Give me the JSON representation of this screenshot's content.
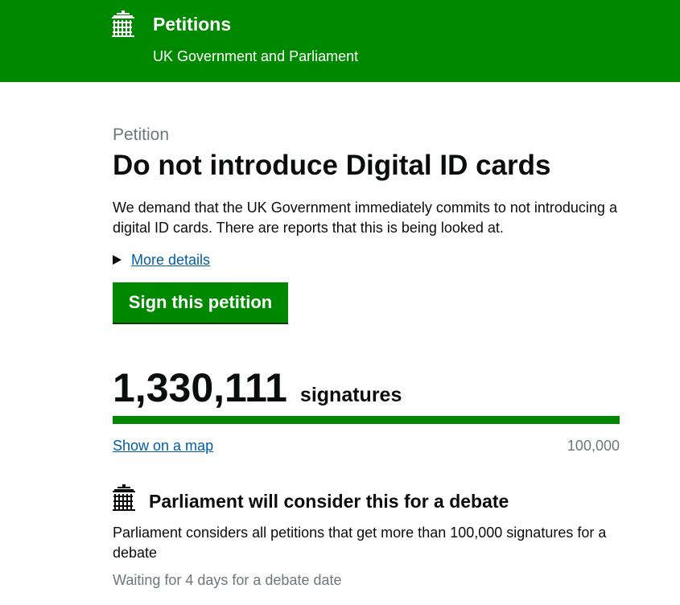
{
  "header": {
    "logo_icon": "portcullis-icon",
    "title": "Petitions",
    "subtitle": "UK Government and Parliament"
  },
  "petition": {
    "kicker": "Petition",
    "title": "Do not introduce Digital ID cards",
    "description": "We demand that the UK Government immediately commits to not introducing a digital ID cards. There are reports that this is being looked at.",
    "more_details": "More details",
    "sign_button": "Sign this petition"
  },
  "signatures": {
    "count": "1,330,111",
    "label": "signatures",
    "progress_fraction": 1.0,
    "map_link": "Show on a map",
    "threshold": "100,000"
  },
  "debate": {
    "icon": "portcullis-icon",
    "title": "Parliament will consider this for a debate",
    "text": "Parliament considers all petitions that get more than 100,000 signatures for a debate",
    "status": "Waiting for 4 days for a debate date"
  },
  "colors": {
    "brand_green": "#008800",
    "link_blue": "#005ea5",
    "secondary_text": "#6f777b",
    "text": "#0b0c0c"
  }
}
